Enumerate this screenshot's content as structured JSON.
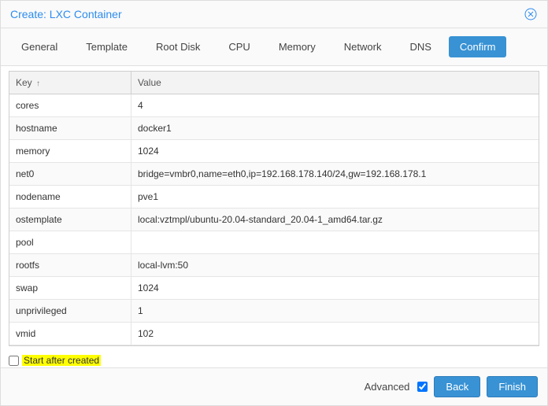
{
  "dialog": {
    "title": "Create: LXC Container"
  },
  "tabs": {
    "items": [
      {
        "label": "General"
      },
      {
        "label": "Template"
      },
      {
        "label": "Root Disk"
      },
      {
        "label": "CPU"
      },
      {
        "label": "Memory"
      },
      {
        "label": "Network"
      },
      {
        "label": "DNS"
      },
      {
        "label": "Confirm",
        "active": true
      }
    ]
  },
  "grid": {
    "columns": {
      "key": "Key",
      "value": "Value"
    },
    "rows": [
      {
        "key": "cores",
        "value": "4"
      },
      {
        "key": "hostname",
        "value": "docker1"
      },
      {
        "key": "memory",
        "value": "1024"
      },
      {
        "key": "net0",
        "value": "bridge=vmbr0,name=eth0,ip=192.168.178.140/24,gw=192.168.178.1"
      },
      {
        "key": "nodename",
        "value": "pve1"
      },
      {
        "key": "ostemplate",
        "value": "local:vztmpl/ubuntu-20.04-standard_20.04-1_amd64.tar.gz"
      },
      {
        "key": "pool",
        "value": ""
      },
      {
        "key": "rootfs",
        "value": "local-lvm:50"
      },
      {
        "key": "swap",
        "value": "1024"
      },
      {
        "key": "unprivileged",
        "value": "1"
      },
      {
        "key": "vmid",
        "value": "102"
      }
    ]
  },
  "footer": {
    "start_after_label": "Start after created",
    "advanced_label": "Advanced",
    "back_label": "Back",
    "finish_label": "Finish",
    "advanced_checked": true,
    "start_after_checked": false
  }
}
